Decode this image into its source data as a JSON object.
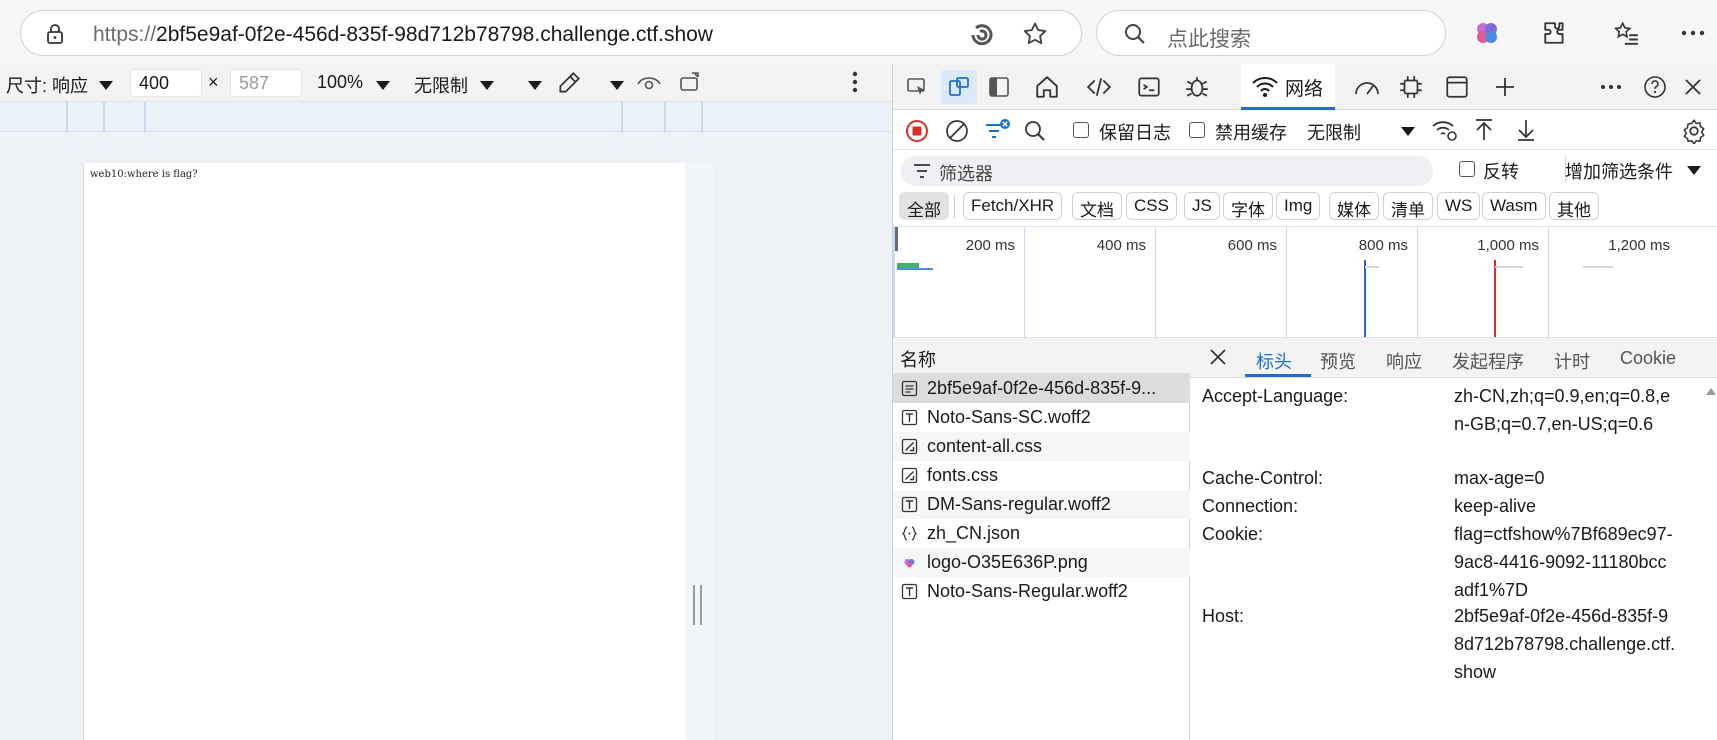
{
  "browser": {
    "url_scheme": "https://",
    "url_host": "2bf5e9af-0f2e-456d-835f-98d712b78798.challenge.ctf.show",
    "search_placeholder": "点此搜索"
  },
  "device_toolbar": {
    "dimensions_label": "尺寸: 响应",
    "width": "400",
    "times": "×",
    "height": "587",
    "zoom": "100%",
    "throttle": "无限制"
  },
  "page_content": {
    "text": "web10:where is flag?"
  },
  "devtools": {
    "network_tab_label": "网络",
    "toolbar": {
      "preserve_log": "保留日志",
      "disable_cache": "禁用缓存",
      "throttle": "无限制"
    },
    "filter": {
      "placeholder": "筛选器",
      "invert": "反转",
      "more_filters": "增加筛选条件"
    },
    "type_filters": [
      "全部",
      "Fetch/XHR",
      "文档",
      "CSS",
      "JS",
      "字体",
      "Img",
      "媒体",
      "清单",
      "WS",
      "Wasm",
      "其他"
    ],
    "timeline_labels": [
      "200 ms",
      "400 ms",
      "600 ms",
      "800 ms",
      "1,000 ms",
      "1,200 ms"
    ],
    "request_list": {
      "header": "名称",
      "rows": [
        {
          "name": "2bf5e9af-0f2e-456d-835f-9...",
          "icon": "document-icon"
        },
        {
          "name": "Noto-Sans-SC.woff2",
          "icon": "font-icon"
        },
        {
          "name": "content-all.css",
          "icon": "stylesheet-icon"
        },
        {
          "name": "fonts.css",
          "icon": "stylesheet-icon"
        },
        {
          "name": "DM-Sans-regular.woff2",
          "icon": "font-icon"
        },
        {
          "name": "zh_CN.json",
          "icon": "json-icon"
        },
        {
          "name": "logo-O35E636P.png",
          "icon": "image-icon"
        },
        {
          "name": "Noto-Sans-Regular.woff2",
          "icon": "font-icon"
        }
      ]
    },
    "detail_tabs": [
      "标头",
      "预览",
      "响应",
      "发起程序",
      "计时",
      "Cookie"
    ],
    "headers": [
      {
        "key": "Accept-Language:",
        "value": "zh-CN,zh;q=0.9,en;q=0.8,en-GB;q=0.7,en-US;q=0.6"
      },
      {
        "key": "Cache-Control:",
        "value": "max-age=0"
      },
      {
        "key": "Connection:",
        "value": "keep-alive"
      },
      {
        "key": "Cookie:",
        "value": "flag=ctfshow%7Bf689ec97-9ac8-4416-9092-11180bccadf1%7D"
      },
      {
        "key": "Host:",
        "value": "2bf5e9af-0f2e-456d-835f-98d712b78798.challenge.ctf.show"
      }
    ]
  },
  "colors": {
    "accent": "#1a6fd0",
    "record": "#d93025"
  }
}
